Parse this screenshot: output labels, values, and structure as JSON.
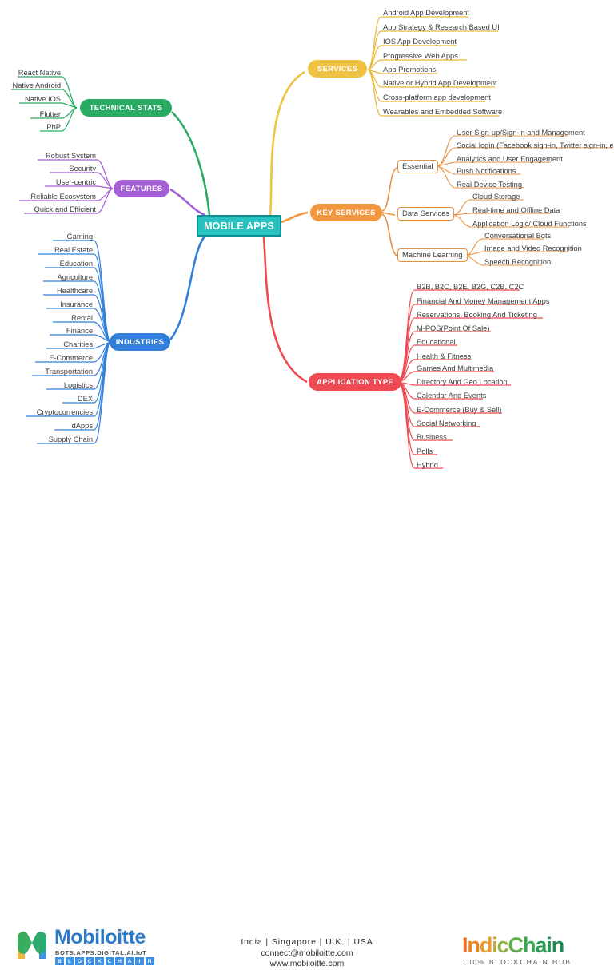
{
  "center": {
    "label": "MOBILE APPS",
    "color": "#27c2bf",
    "border": "#0f8f99"
  },
  "branches": {
    "technical_stats": {
      "label": "TECHNICAL STATS",
      "color": "#2aab63",
      "items": [
        "React Native",
        "Native Android",
        "Native IOS",
        "Flutter",
        "PhP"
      ]
    },
    "features": {
      "label": "FEATURES",
      "color": "#a55fd6",
      "items": [
        "Robust System",
        "Security",
        "User-centric",
        "Reliable Ecosystem",
        "Quick and Efficient"
      ]
    },
    "industries": {
      "label": "INDUSTRIES",
      "color": "#2f7fdb",
      "items": [
        "Gaming",
        "Real Estate",
        "Education",
        "Agriculture",
        "Healthcare",
        "Insurance",
        "Rental",
        "Finance",
        "Charities",
        "E-Commerce",
        "Transportation",
        "Logistics",
        "DEX",
        "Cryptocurrencies",
        "dApps",
        "Supply Chain"
      ]
    },
    "services": {
      "label": "SERVICES",
      "color": "#f0c244",
      "items": [
        "Android App Development",
        "App Strategy & Research Based UI",
        "IOS App Development",
        "Progressive Web Apps",
        "App Promotions",
        "Native or Hybrid App Development",
        "Cross-platform app development",
        "Wearables and Embedded Software"
      ]
    },
    "key_services": {
      "label": "KEY SERVICES",
      "color": "#f0973f",
      "groups": [
        {
          "label": "Essential",
          "items": [
            "User Sign-up/Sign-in and Management",
            "Social login (Facebook sign-in, Twitter sign-in, etc.)",
            "Analytics and User Engagement",
            "Push Notifications",
            "Real Device Testing"
          ]
        },
        {
          "label": "Data Services",
          "items": [
            "Cloud Storage",
            "Real-time and Offline Data",
            "Application Logic/ Cloud Functions"
          ]
        },
        {
          "label": "Machine Learning",
          "items": [
            "Conversational Bots",
            "Image and Video Recognition",
            "Speech Recognition"
          ]
        }
      ]
    },
    "application_type": {
      "label": "APPLICATION TYPE",
      "color": "#ee4a52",
      "items": [
        "B2B, B2C, B2E, B2G, C2B, C2C",
        "Financial And Money Management Apps",
        "Reservations, Booking And Ticketing",
        "M-POS(Point Of Sale)",
        "Educational",
        "Health & Fitness",
        "Games And Multimedia",
        "Directory And Geo Location",
        "Calendar And Events",
        "E-Commerce (Buy & Sell)",
        "Social Networking",
        "Business",
        "Polls",
        "Hybrid"
      ]
    }
  },
  "footer": {
    "mobiloitte": {
      "wordmark": "Mobiloitte",
      "tagline": "BOTS.APPS.DIGITAL.AI.IoT",
      "blockchain": "BLOCKCHAIN"
    },
    "contact": {
      "locations": "India  |  Singapore  |  U.K.  |  USA",
      "email": "connect@mobiloitte.com",
      "website": "www.mobiloitte.com"
    },
    "indicchain": {
      "wordmark": "IndicChain",
      "tagline": "100% BLOCKCHAIN HUB"
    }
  }
}
